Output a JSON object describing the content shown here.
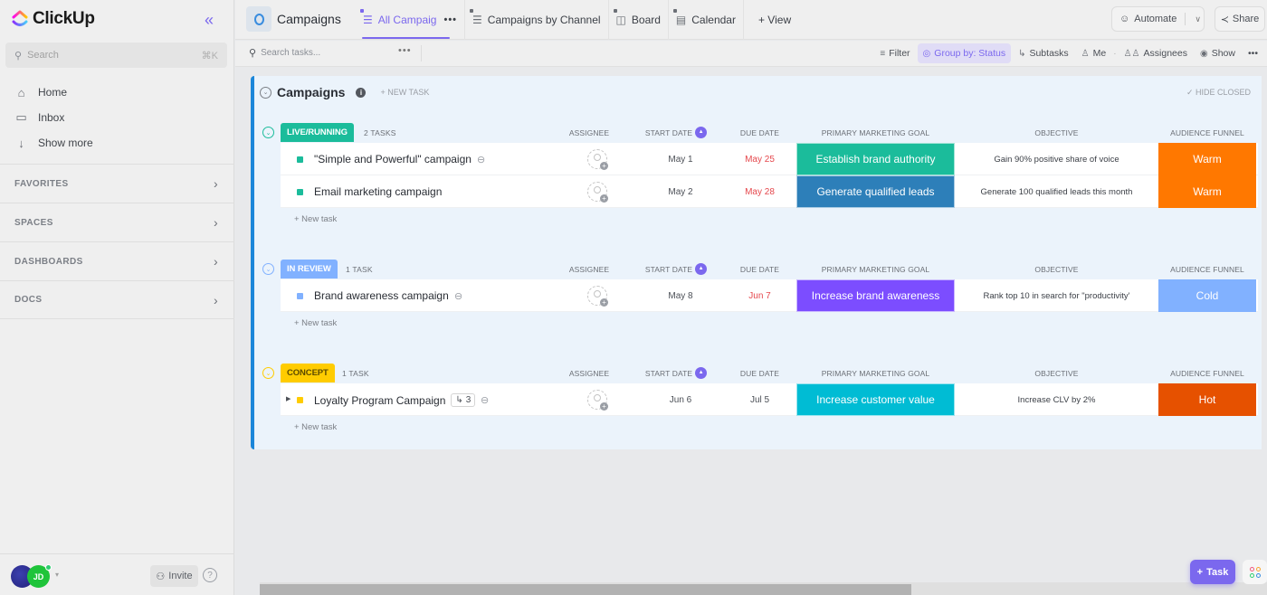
{
  "app": {
    "brand": "ClickUp",
    "colors": {
      "accent": "#7b68ee",
      "list_border": "#1b86d9"
    }
  },
  "sidebar": {
    "search": {
      "placeholder": "Search",
      "shortcut": "⌘K"
    },
    "nav": [
      {
        "label": "Home",
        "icon": "home-icon"
      },
      {
        "label": "Inbox",
        "icon": "inbox-icon"
      },
      {
        "label": "Show more",
        "icon": "arrow-down-icon"
      }
    ],
    "sections": [
      {
        "label": "FAVORITES"
      },
      {
        "label": "SPACES"
      },
      {
        "label": "DASHBOARDS"
      },
      {
        "label": "DOCS"
      }
    ],
    "footer": {
      "avatar_initials": "JD",
      "invite_label": "Invite",
      "help": "?"
    }
  },
  "header": {
    "space_title": "Campaigns",
    "tabs": [
      {
        "label": "All Campaig",
        "active": true,
        "more": "•••"
      },
      {
        "label": "Campaigns by Channel",
        "active": false
      },
      {
        "label": "Board",
        "active": false
      },
      {
        "label": "Calendar",
        "active": false
      }
    ],
    "add_view": "+ View",
    "automate_label": "Automate",
    "share_label": "Share"
  },
  "toolbar": {
    "search_placeholder": "Search tasks...",
    "more": "•••",
    "filter": "Filter",
    "group_by": "Group by: Status",
    "subtasks": "Subtasks",
    "me": "Me",
    "assignees": "Assignees",
    "show": "Show",
    "overflow": "•••"
  },
  "list": {
    "title": "Campaigns",
    "new_task_top": "+ NEW TASK",
    "hide_closed": "✓ HIDE CLOSED",
    "columns": {
      "assignee": "ASSIGNEE",
      "start_date": "START DATE",
      "due_date": "DUE DATE",
      "goal": "PRIMARY MARKETING GOAL",
      "objective": "OBJECTIVE",
      "funnel": "AUDIENCE FUNNEL"
    },
    "new_task_row": "+ New task",
    "groups": [
      {
        "status": "LIVE/RUNNING",
        "count": "2 TASKS",
        "color": "#1bbc9b",
        "tasks": [
          {
            "name": "\"Simple and Powerful\" campaign",
            "attachment": true,
            "start": "May 1",
            "due": "May 25",
            "overdue": true,
            "goal": "Establish brand authority",
            "goal_color": "#1bbc9b",
            "objective": "Gain 90% positive share of voice",
            "funnel": "Warm",
            "funnel_color": "#ff7800"
          },
          {
            "name": "Email marketing campaign",
            "attachment": false,
            "start": "May 2",
            "due": "May 28",
            "overdue": true,
            "goal": "Generate qualified leads",
            "goal_color": "#2d7fb9",
            "objective": "Generate 100 qualified leads this month",
            "funnel": "Warm",
            "funnel_color": "#ff7800"
          }
        ]
      },
      {
        "status": "IN REVIEW",
        "count": "1 TASK",
        "color": "#81b1ff",
        "tasks": [
          {
            "name": "Brand awareness campaign",
            "attachment": true,
            "start": "May 8",
            "due": "Jun 7",
            "overdue": true,
            "goal": "Increase brand awareness",
            "goal_color": "#7c4dff",
            "objective": "Rank top 10 in search for \"productivity'",
            "funnel": "Cold",
            "funnel_color": "#81b1ff"
          }
        ]
      },
      {
        "status": "CONCEPT",
        "count": "1 TASK",
        "color": "#ffcc00",
        "tasks": [
          {
            "name": "Loyalty Program Campaign",
            "attachment": true,
            "subtasks": "3",
            "start": "Jun 6",
            "due": "Jul 5",
            "overdue": false,
            "goal": "Increase customer value",
            "goal_color": "#00bcd4",
            "objective": "Increase CLV by 2%",
            "funnel": "Hot",
            "funnel_color": "#e65100"
          }
        ]
      }
    ]
  },
  "fab": {
    "task_label": "Task"
  }
}
